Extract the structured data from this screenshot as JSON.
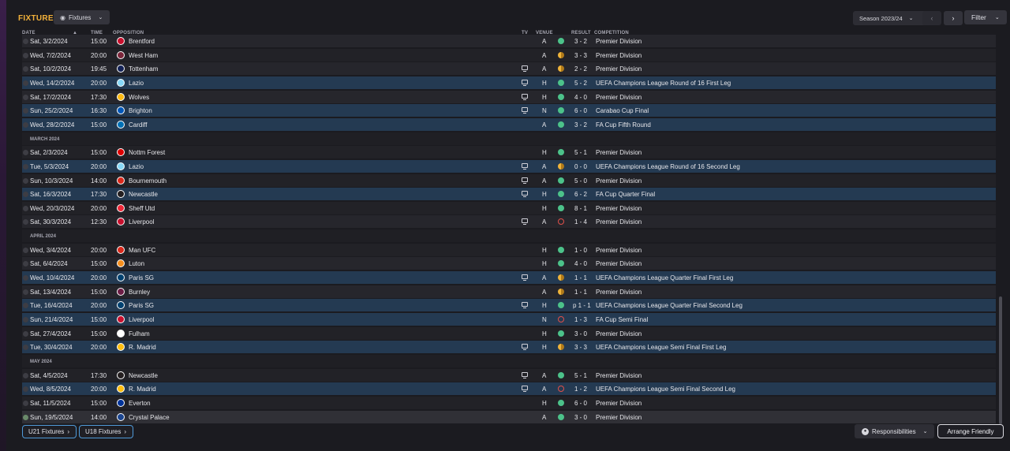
{
  "header": {
    "title": "FIXTURES",
    "view_label": "Fixtures",
    "season_label": "Season 2023/24",
    "filter_label": "Filter"
  },
  "columns": {
    "date": "DATE",
    "time": "TIME",
    "opposition": "OPPOSITION",
    "tv": "TV",
    "venue": "VENUE",
    "result": "RESULT",
    "competition": "COMPETITION"
  },
  "rows": [
    {
      "kind": "match",
      "date": "Sat, 3/2/2024",
      "time": "15:00",
      "opponent": "Brentford",
      "badge": "#c8102e",
      "tv": false,
      "venue": "A",
      "outcome": "win",
      "result": "3 - 2",
      "competition": "Premier Division",
      "cup": false
    },
    {
      "kind": "match",
      "date": "Wed, 7/2/2024",
      "time": "20:00",
      "opponent": "West Ham",
      "badge": "#7a263a",
      "tv": false,
      "venue": "A",
      "outcome": "draw",
      "result": "3 - 3",
      "competition": "Premier Division",
      "cup": false
    },
    {
      "kind": "match",
      "date": "Sat, 10/2/2024",
      "time": "19:45",
      "opponent": "Tottenham",
      "badge": "#132257",
      "tv": true,
      "venue": "A",
      "outcome": "draw",
      "result": "2 - 2",
      "competition": "Premier Division",
      "cup": false
    },
    {
      "kind": "match",
      "date": "Wed, 14/2/2024",
      "time": "20:00",
      "opponent": "Lazio",
      "badge": "#87d8f7",
      "tv": true,
      "venue": "H",
      "outcome": "win",
      "result": "5 - 2",
      "competition": "UEFA Champions League Round of 16 First Leg",
      "cup": true
    },
    {
      "kind": "match",
      "date": "Sat, 17/2/2024",
      "time": "17:30",
      "opponent": "Wolves",
      "badge": "#fdb913",
      "tv": true,
      "venue": "H",
      "outcome": "win",
      "result": "4 - 0",
      "competition": "Premier Division",
      "cup": false
    },
    {
      "kind": "match",
      "date": "Sun, 25/2/2024",
      "time": "16:30",
      "opponent": "Brighton",
      "badge": "#0057b8",
      "tv": true,
      "venue": "N",
      "outcome": "win",
      "result": "6 - 0",
      "competition": "Carabao Cup Final",
      "cup": true
    },
    {
      "kind": "match",
      "date": "Wed, 28/2/2024",
      "time": "15:00",
      "opponent": "Cardiff",
      "badge": "#0070b5",
      "tv": false,
      "venue": "A",
      "outcome": "win",
      "result": "3 - 2",
      "competition": "FA Cup Fifth Round",
      "cup": true
    },
    {
      "kind": "month",
      "label": "MARCH 2024"
    },
    {
      "kind": "match",
      "date": "Sat, 2/3/2024",
      "time": "15:00",
      "opponent": "Nottm Forest",
      "badge": "#dd0000",
      "tv": false,
      "venue": "H",
      "outcome": "win",
      "result": "5 - 1",
      "competition": "Premier Division",
      "cup": false
    },
    {
      "kind": "match",
      "date": "Tue, 5/3/2024",
      "time": "20:00",
      "opponent": "Lazio",
      "badge": "#87d8f7",
      "tv": true,
      "venue": "A",
      "outcome": "draw",
      "result": "0 - 0",
      "competition": "UEFA Champions League Round of 16 Second Leg",
      "cup": true
    },
    {
      "kind": "match",
      "date": "Sun, 10/3/2024",
      "time": "14:00",
      "opponent": "Bournemouth",
      "badge": "#da291c",
      "tv": true,
      "venue": "A",
      "outcome": "win",
      "result": "5 - 0",
      "competition": "Premier Division",
      "cup": false
    },
    {
      "kind": "match",
      "date": "Sat, 16/3/2024",
      "time": "17:30",
      "opponent": "Newcastle",
      "badge": "#241f20",
      "tv": true,
      "venue": "H",
      "outcome": "win",
      "result": "6 - 2",
      "competition": "FA Cup Quarter Final",
      "cup": true
    },
    {
      "kind": "match",
      "date": "Wed, 20/3/2024",
      "time": "20:00",
      "opponent": "Sheff Utd",
      "badge": "#ee2737",
      "tv": false,
      "venue": "H",
      "outcome": "win",
      "result": "8 - 1",
      "competition": "Premier Division",
      "cup": false
    },
    {
      "kind": "match",
      "date": "Sat, 30/3/2024",
      "time": "12:30",
      "opponent": "Liverpool",
      "badge": "#c8102e",
      "tv": true,
      "venue": "A",
      "outcome": "loss",
      "result": "1 - 4",
      "competition": "Premier Division",
      "cup": false
    },
    {
      "kind": "month",
      "label": "APRIL 2024"
    },
    {
      "kind": "match",
      "date": "Wed, 3/4/2024",
      "time": "20:00",
      "opponent": "Man UFC",
      "badge": "#da291c",
      "tv": false,
      "venue": "H",
      "outcome": "win",
      "result": "1 - 0",
      "competition": "Premier Division",
      "cup": false
    },
    {
      "kind": "match",
      "date": "Sat, 6/4/2024",
      "time": "15:00",
      "opponent": "Luton",
      "badge": "#f78f1e",
      "tv": false,
      "venue": "H",
      "outcome": "win",
      "result": "4 - 0",
      "competition": "Premier Division",
      "cup": false
    },
    {
      "kind": "match",
      "date": "Wed, 10/4/2024",
      "time": "20:00",
      "opponent": "Paris SG",
      "badge": "#004170",
      "tv": true,
      "venue": "A",
      "outcome": "draw",
      "result": "1 - 1",
      "competition": "UEFA Champions League Quarter Final First Leg",
      "cup": true
    },
    {
      "kind": "match",
      "date": "Sat, 13/4/2024",
      "time": "15:00",
      "opponent": "Burnley",
      "badge": "#6c1d45",
      "tv": false,
      "venue": "A",
      "outcome": "draw",
      "result": "1 - 1",
      "competition": "Premier Division",
      "cup": false
    },
    {
      "kind": "match",
      "date": "Tue, 16/4/2024",
      "time": "20:00",
      "opponent": "Paris SG",
      "badge": "#004170",
      "tv": true,
      "venue": "H",
      "outcome": "win",
      "result": "p 1 - 1",
      "competition": "UEFA Champions League Quarter Final Second Leg",
      "cup": true
    },
    {
      "kind": "match",
      "date": "Sun, 21/4/2024",
      "time": "15:00",
      "opponent": "Liverpool",
      "badge": "#c8102e",
      "tv": false,
      "venue": "N",
      "outcome": "loss",
      "result": "1 - 3",
      "competition": "FA Cup Semi Final",
      "cup": true
    },
    {
      "kind": "match",
      "date": "Sat, 27/4/2024",
      "time": "15:00",
      "opponent": "Fulham",
      "badge": "#ffffff",
      "tv": false,
      "venue": "H",
      "outcome": "win",
      "result": "3 - 0",
      "competition": "Premier Division",
      "cup": false
    },
    {
      "kind": "match",
      "date": "Tue, 30/4/2024",
      "time": "20:00",
      "opponent": "R. Madrid",
      "badge": "#febe10",
      "tv": true,
      "venue": "H",
      "outcome": "draw",
      "result": "3 - 3",
      "competition": "UEFA Champions League Semi Final First Leg",
      "cup": true
    },
    {
      "kind": "month",
      "label": "MAY 2024"
    },
    {
      "kind": "match",
      "date": "Sat, 4/5/2024",
      "time": "17:30",
      "opponent": "Newcastle",
      "badge": "#241f20",
      "tv": true,
      "venue": "A",
      "outcome": "win",
      "result": "5 - 1",
      "competition": "Premier Division",
      "cup": false
    },
    {
      "kind": "match",
      "date": "Wed, 8/5/2024",
      "time": "20:00",
      "opponent": "R. Madrid",
      "badge": "#febe10",
      "tv": true,
      "venue": "A",
      "outcome": "loss",
      "result": "1 - 2",
      "competition": "UEFA Champions League Semi Final Second Leg",
      "cup": true
    },
    {
      "kind": "match",
      "date": "Sat, 11/5/2024",
      "time": "15:00",
      "opponent": "Everton",
      "badge": "#003399",
      "tv": false,
      "venue": "H",
      "outcome": "win",
      "result": "6 - 0",
      "competition": "Premier Division",
      "cup": false
    },
    {
      "kind": "match",
      "date": "Sun, 19/5/2024",
      "time": "14:00",
      "opponent": "Crystal Palace",
      "badge": "#1b458f",
      "tv": false,
      "venue": "A",
      "outcome": "win",
      "result": "3 - 0",
      "competition": "Premier Division",
      "cup": false,
      "last": true
    }
  ],
  "footer": {
    "u21_label": "U21 Fixtures",
    "u18_label": "U18 Fixtures",
    "responsibilities_label": "Responsibilities",
    "arrange_label": "Arrange Friendly"
  },
  "icons": {
    "view": "eye-icon",
    "dropdown": "chevron-down-icon",
    "prev": "chevron-left-icon",
    "next": "chevron-right-icon",
    "tv": "tv-icon",
    "responsibilities": "person-icon"
  },
  "colors": {
    "accent": "#f2b13a",
    "cup_row": "#243a52",
    "win": "#4cc28a",
    "draw": "#f0b43a",
    "loss": "#e0504a",
    "link_border": "#4f9ad8"
  }
}
